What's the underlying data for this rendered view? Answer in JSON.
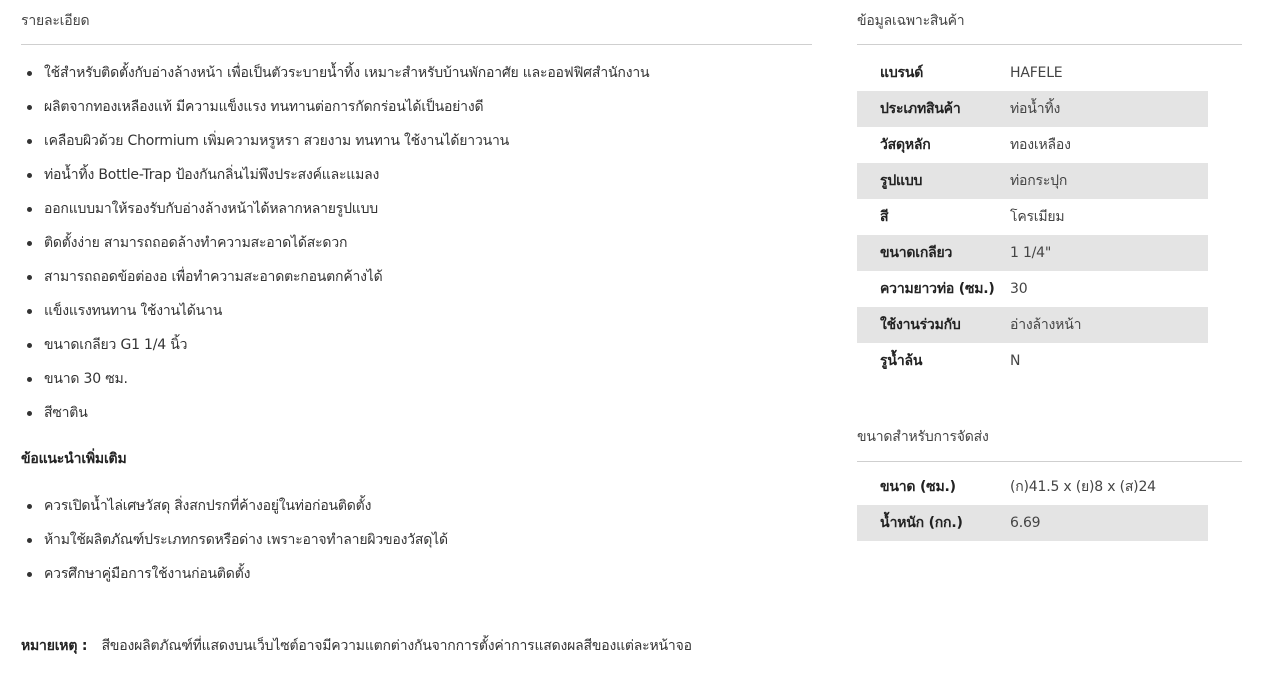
{
  "details": {
    "title": "รายละเอียด",
    "bullets": [
      "ใช้สำหรับติดตั้งกับอ่างล้างหน้า เพื่อเป็นตัวระบายน้ำทิ้ง เหมาะสำหรับบ้านพักอาศัย และออฟฟิศสำนักงาน",
      "ผลิตจากทองเหลืองแท้ มีความแข็งแรง ทนทานต่อการกัดกร่อนได้เป็นอย่างดี",
      "เคลือบผิวด้วย Chormium เพิ่มความหรูหรา สวยงาม ทนทาน ใช้งานได้ยาวนาน",
      "ท่อน้ำทิ้ง Bottle-Trap ป้องกันกลิ่นไม่พึงประสงค์และแมลง",
      "ออกแบบมาให้รองรับกับอ่างล้างหน้าได้หลากหลายรูปแบบ",
      "ติดตั้งง่าย สามารถถอดล้างทำความสะอาดได้สะดวก",
      "สามารถถอดข้อต่องอ เพื่อทำความสะอาดตะกอนตกค้างได้",
      "แข็งแรงทนทาน ใช้งานได้นาน",
      "ขนาดเกลียว G1 1/4 นิ้ว",
      "ขนาด 30 ซม.",
      "สีซาติน"
    ]
  },
  "tips": {
    "title": "ข้อแนะนำเพิ่มเติม",
    "items": [
      "ควรเปิดน้ำไล่เศษวัสดุ สิ่งสกปรกที่ค้างอยู่ในท่อก่อนติดตั้ง",
      "ห้ามใช้ผลิตภัณฑ์ประเภทกรดหรือด่าง เพราะอาจทำลายผิวของวัสดุได้",
      "ควรศึกษาคู่มือการใช้งานก่อนติดตั้ง"
    ]
  },
  "note": {
    "label": "หมายเหตุ :",
    "text": "สีของผลิตภัณฑ์ที่แสดงบนเว็บไซต์อาจมีความแตกต่างกันจากการตั้งค่าการแสดงผลสีของแต่ละหน้าจอ"
  },
  "specs": {
    "title": "ข้อมูลเฉพาะสินค้า",
    "rows": [
      {
        "key": "แบรนด์",
        "value": "HAFELE"
      },
      {
        "key": "ประเภทสินค้า",
        "value": "ท่อน้ำทิ้ง"
      },
      {
        "key": "วัสดุหลัก",
        "value": "ทองเหลือง"
      },
      {
        "key": "รูปแบบ",
        "value": "ท่อกระปุก"
      },
      {
        "key": "สี",
        "value": "โครเมียม"
      },
      {
        "key": "ขนาดเกลียว",
        "value": "1 1/4\""
      },
      {
        "key": "ความยาวท่อ (ซม.)",
        "value": "30"
      },
      {
        "key": "ใช้งานร่วมกับ",
        "value": "อ่างล้างหน้า"
      },
      {
        "key": "รูน้ำล้น",
        "value": "N"
      }
    ]
  },
  "shipping": {
    "title": "ขนาดสำหรับการจัดส่ง",
    "rows": [
      {
        "key": "ขนาด (ซม.)",
        "value": "(ก)41.5 x (ย)8 x (ส)24"
      },
      {
        "key": "น้ำหนัก (กก.)",
        "value": "6.69"
      }
    ]
  },
  "colors": {
    "row_shade": "#e4e4e4",
    "divider": "#cfcfcf",
    "text": "#333333"
  }
}
